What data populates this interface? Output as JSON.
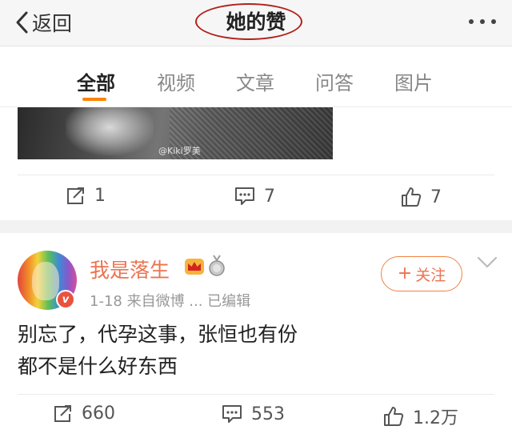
{
  "navbar": {
    "back_label": "返回",
    "title": "她的赞"
  },
  "tabs": [
    {
      "label": "全部",
      "active": true
    },
    {
      "label": "视频",
      "active": false
    },
    {
      "label": "文章",
      "active": false
    },
    {
      "label": "问答",
      "active": false
    },
    {
      "label": "图片",
      "active": false
    }
  ],
  "previous_post": {
    "image_watermark": "@Kiki罗美",
    "actions": {
      "repost_count": "1",
      "comment_count": "7",
      "like_count": "7"
    }
  },
  "post": {
    "username": "我是落生",
    "verified_badge": "v",
    "meta": "1-18  来自微博 ...  已编辑",
    "follow_label": "关注",
    "follow_plus": "+",
    "content_line1": "别忘了，代孕这事，张恒也有份",
    "content_line2": "都不是什么好东西",
    "actions": {
      "repost_count": "660",
      "comment_count": "553",
      "like_count": "1.2万"
    }
  },
  "colors": {
    "accent_orange": "#ff8200",
    "username_orange": "#eb7350",
    "highlight_circle": "#b2201a"
  },
  "icons": [
    "chevron-left-icon",
    "more-icon",
    "repost-icon",
    "comment-icon",
    "like-icon",
    "crown-icon",
    "medal-icon",
    "chevron-down-icon"
  ]
}
